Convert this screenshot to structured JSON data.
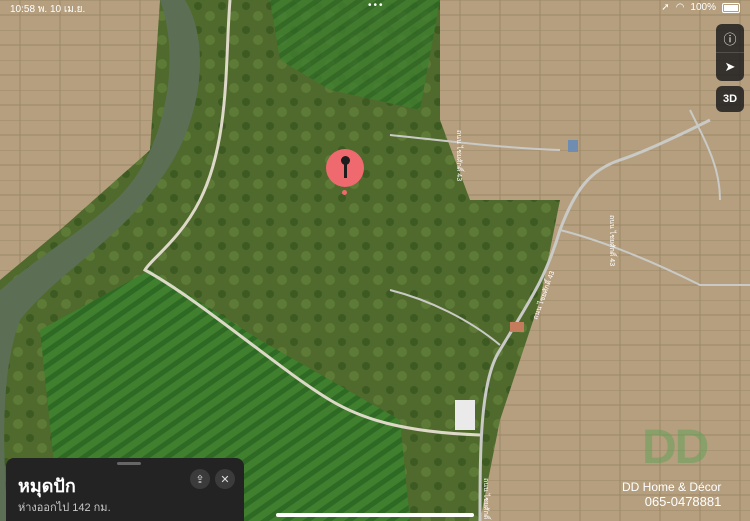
{
  "status_bar": {
    "time": "10:58",
    "date": "พ. 10 เม.ย.",
    "battery": "100%"
  },
  "map_controls": {
    "info_icon": "info-icon",
    "location_icon": "location-arrow-icon",
    "three_d_label": "3D"
  },
  "place_card": {
    "title": "หมุดปัก",
    "distance": "ห่างออกไป 142 กม.",
    "share_icon": "share-icon",
    "close_icon": "close-icon"
  },
  "road_labels": [
    "ถนน ไชยศักดิ์ 43",
    "ถนน ไชยศักดิ์ 43",
    "ถนน ไชยศักดิ์ 43",
    "ถนน ไชยศักดิ์ 1001"
  ],
  "watermark": {
    "logo": "DD",
    "line1": "DD Home & Décor",
    "line2": "065-0478881"
  },
  "colors": {
    "pin": "#ef6a6f",
    "card_bg": "#232323",
    "river": "#5c6f55"
  }
}
